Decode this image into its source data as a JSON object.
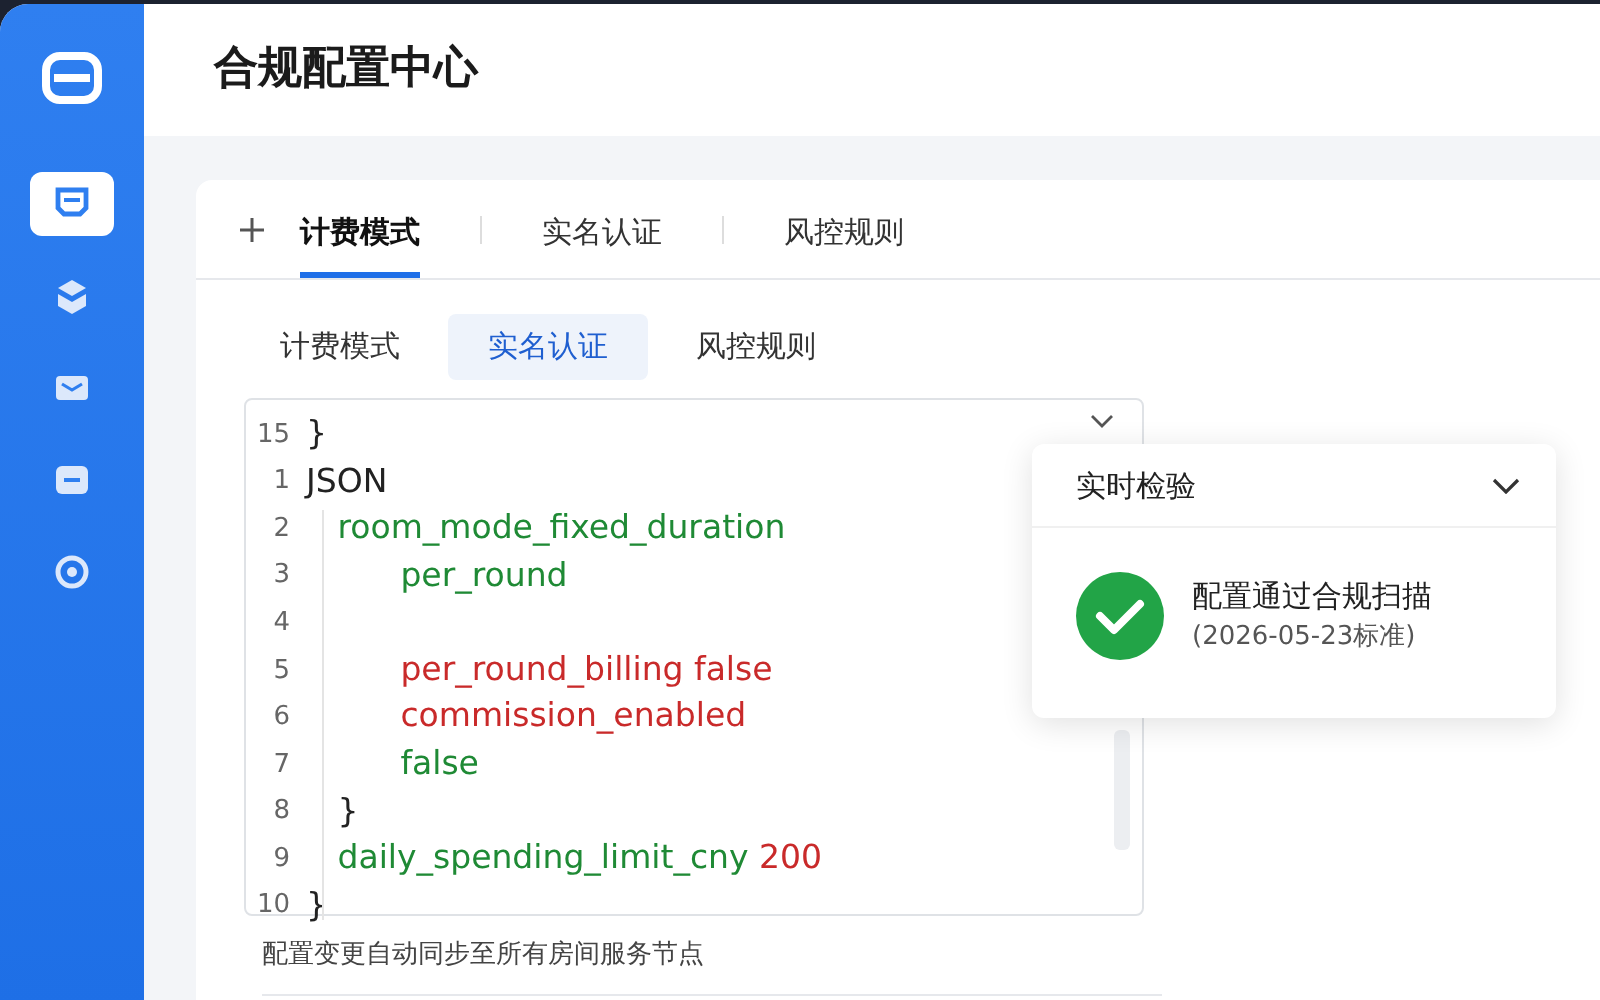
{
  "header": {
    "title": "合规配置中心"
  },
  "sidebar": {
    "items": [
      {
        "selected": true
      },
      {
        "selected": false
      },
      {
        "selected": false
      },
      {
        "selected": false
      },
      {
        "selected": false
      }
    ]
  },
  "tabs": [
    {
      "label": "计费模式",
      "selected": true
    },
    {
      "label": "实名认证",
      "selected": false
    },
    {
      "label": "风控规则",
      "selected": false
    }
  ],
  "subtabs": [
    {
      "label": "计费模式",
      "selected": false
    },
    {
      "label": "实名认证",
      "selected": true
    },
    {
      "label": "风控规则",
      "selected": false
    }
  ],
  "code": {
    "lines": [
      {
        "number": "15",
        "segments": [
          {
            "text": "}",
            "kind": "plain"
          }
        ]
      },
      {
        "number": "1",
        "segments": [
          {
            "text": "JSON",
            "kind": "plain"
          }
        ]
      },
      {
        "number": "2",
        "segments": [
          {
            "text": "   room_mode_fixed_duration",
            "kind": "ok"
          }
        ]
      },
      {
        "number": "3",
        "segments": [
          {
            "text": "         per_round",
            "kind": "ok"
          }
        ]
      },
      {
        "number": "4"
      },
      {
        "number": "5",
        "segments": [
          {
            "text": "         per_round_billing false",
            "kind": "error"
          }
        ]
      },
      {
        "number": "6",
        "segments": [
          {
            "text": "         commission_enabled",
            "kind": "error"
          }
        ]
      },
      {
        "number": "7",
        "segments": [
          {
            "text": "         false",
            "kind": "ok"
          }
        ]
      },
      {
        "number": "8",
        "segments": [
          {
            "text": "   }",
            "kind": "plain"
          }
        ]
      },
      {
        "number": "9",
        "segments": [
          {
            "text": "   daily_spending_limit_cny",
            "kind": "ok"
          },
          {
            "text": " 200",
            "kind": "error"
          }
        ]
      },
      {
        "number": "10",
        "segments": [
          {
            "text": "}",
            "kind": "plain"
          }
        ]
      }
    ]
  },
  "check_panel": {
    "title": "实时检验",
    "status": "配置通过合规扫描",
    "detail": "(2026-05-23标准)"
  },
  "footer_note": "配置变更自动同步至所有房间服务节点"
}
